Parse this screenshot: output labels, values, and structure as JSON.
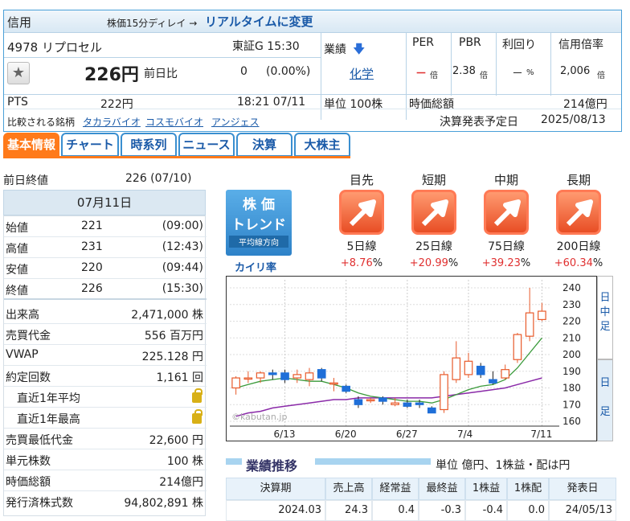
{
  "header": {
    "tag": "信用",
    "delay_note": "株価15分ディレイ →",
    "realtime_link": "リアルタイムに変更",
    "code_name": "4978 リプロセル",
    "market_time": "東証G  15:30",
    "price": "226円",
    "prev_label": "前日比",
    "change": "0",
    "change_pct": "(0.00%)",
    "pts_label": "PTS",
    "pts_price": "222円",
    "pts_time": "18:21  07/11",
    "industry_label": "業績",
    "industry_value": "化学",
    "unit_label": "単位 100株",
    "per_label": "PER",
    "per_value": "－",
    "per_unit": "倍",
    "pbr_label": "PBR",
    "pbr_value": "2.38",
    "pbr_unit": "倍",
    "yield_label": "利回り",
    "yield_value": "－",
    "yield_unit": "%",
    "margin_label": "信用倍率",
    "margin_value": "2,006",
    "margin_unit": "倍",
    "mcap_label": "時価総額",
    "mcap_value": "214億円",
    "compare_label": "比較される銘柄",
    "compare_items": [
      "タカラバイオ",
      "コスモバイオ",
      "アンジェス"
    ],
    "earnings_label": "決算発表予定日",
    "earnings_date": "2025/08/13"
  },
  "tabs": [
    "基本情報",
    "チャート",
    "時系列",
    "ニュース",
    "決算",
    "大株主"
  ],
  "left": {
    "prev_close_label": "前日終値",
    "prev_close_value": "226 (07/10)",
    "date": "07月11日",
    "ohlc": [
      {
        "k": "始値",
        "v": "221",
        "t": "(09:00)"
      },
      {
        "k": "高値",
        "v": "231",
        "t": "(12:43)"
      },
      {
        "k": "安値",
        "v": "220",
        "t": "(09:44)"
      },
      {
        "k": "終値",
        "v": "226",
        "t": "(15:30)"
      }
    ],
    "stats": [
      {
        "k": "出来高",
        "v": "2,471,000 株"
      },
      {
        "k": "売買代金",
        "v": "556 百万円"
      },
      {
        "k": "VWAP",
        "v": "225.128 円"
      },
      {
        "k": "約定回数",
        "v": "1,161 回"
      },
      {
        "k": "直近1年平均",
        "v": ""
      },
      {
        "k": "直近1年最高",
        "v": ""
      },
      {
        "k": "売買最低代金",
        "v": "22,600 円"
      },
      {
        "k": "単元株数",
        "v": "100 株"
      },
      {
        "k": "時価総額",
        "v": "214億円"
      },
      {
        "k": "発行済株式数",
        "v": "94,802,891 株"
      }
    ]
  },
  "trend": {
    "badge_line1": "株 価",
    "badge_line2": "トレンド",
    "badge_line3": "平均線方向",
    "kairi_label": "カイリ率",
    "items": [
      {
        "name": "目先",
        "line": "5日線",
        "pct": "+8.76",
        "unit": "%"
      },
      {
        "name": "短期",
        "line": "25日線",
        "pct": "+20.99",
        "unit": "%"
      },
      {
        "name": "中期",
        "line": "75日線",
        "pct": "+39.23",
        "unit": "%"
      },
      {
        "name": "長期",
        "line": "200日線",
        "pct": "+60.34",
        "unit": "%"
      }
    ]
  },
  "chart": {
    "watermark": "©kabutan.jp",
    "x_labels": [
      "6/13",
      "6/20",
      "6/27",
      "7/4",
      "7/11"
    ],
    "y_labels": [
      "240",
      "230",
      "220",
      "210",
      "200",
      "190",
      "180",
      "170",
      "160"
    ],
    "side_tabs": [
      [
        "日",
        "中",
        "足"
      ],
      [
        "日",
        "足"
      ]
    ],
    "ymin": 160,
    "ymax": 240,
    "candles": [
      {
        "o": 180,
        "h": 187,
        "l": 176,
        "c": 186
      },
      {
        "o": 186,
        "h": 190,
        "l": 183,
        "c": 186
      },
      {
        "o": 186,
        "h": 190,
        "l": 183,
        "c": 189
      },
      {
        "o": 189,
        "h": 191,
        "l": 185,
        "c": 188
      },
      {
        "o": 189,
        "h": 191,
        "l": 183,
        "c": 185
      },
      {
        "o": 186,
        "h": 191,
        "l": 183,
        "c": 188
      },
      {
        "o": 185,
        "h": 192,
        "l": 181,
        "c": 189
      },
      {
        "o": 191,
        "h": 192,
        "l": 184,
        "c": 186
      },
      {
        "o": 183,
        "h": 186,
        "l": 178,
        "c": 183
      },
      {
        "o": 181,
        "h": 182,
        "l": 177,
        "c": 178
      },
      {
        "o": 173,
        "h": 175,
        "l": 168,
        "c": 170
      },
      {
        "o": 173,
        "h": 174,
        "l": 171,
        "c": 173
      },
      {
        "o": 174,
        "h": 175,
        "l": 170,
        "c": 172
      },
      {
        "o": 170,
        "h": 174,
        "l": 169,
        "c": 171
      },
      {
        "o": 171,
        "h": 173,
        "l": 168,
        "c": 169
      },
      {
        "o": 171,
        "h": 173,
        "l": 168,
        "c": 170
      },
      {
        "o": 168,
        "h": 169,
        "l": 165,
        "c": 165
      },
      {
        "o": 167,
        "h": 190,
        "l": 165,
        "c": 188
      },
      {
        "o": 185,
        "h": 208,
        "l": 183,
        "c": 198
      },
      {
        "o": 188,
        "h": 201,
        "l": 186,
        "c": 196
      },
      {
        "o": 193,
        "h": 195,
        "l": 186,
        "c": 188
      },
      {
        "o": 185,
        "h": 190,
        "l": 182,
        "c": 183
      },
      {
        "o": 186,
        "h": 194,
        "l": 185,
        "c": 191
      },
      {
        "o": 197,
        "h": 213,
        "l": 195,
        "c": 212
      },
      {
        "o": 211,
        "h": 240,
        "l": 208,
        "c": 225
      },
      {
        "o": 221,
        "h": 231,
        "l": 220,
        "c": 226
      }
    ],
    "ma_green": [
      180,
      182,
      184,
      185,
      186,
      185,
      184,
      184,
      182,
      180,
      177,
      175,
      174,
      173,
      172,
      172,
      171,
      173,
      176,
      179,
      181,
      182,
      185,
      192,
      201,
      210
    ],
    "ma_purple": [
      163,
      165,
      166,
      168,
      169,
      170,
      171,
      172,
      173,
      173,
      174,
      174,
      174,
      174,
      174,
      174,
      174,
      175,
      176,
      177,
      178,
      179,
      180,
      182,
      184,
      186
    ]
  },
  "perf": {
    "title": "業績推移",
    "unit_note": "単位 億円、1株益・配は円",
    "headers": [
      "決算期",
      "売上高",
      "経常益",
      "最終益",
      "1株益",
      "1株配",
      "発表日"
    ],
    "rows": [
      [
        "2024.03",
        "24.3",
        "0.4",
        "-0.3",
        "-0.4",
        "0.0",
        "24/05/13"
      ]
    ]
  }
}
